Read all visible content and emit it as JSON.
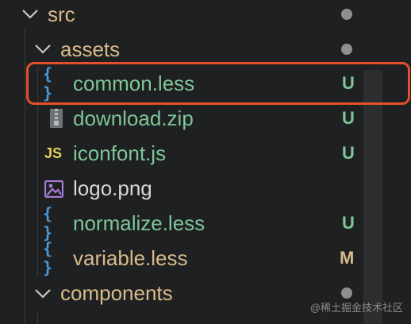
{
  "explorer": {
    "items": [
      {
        "label": "src",
        "type": "folder",
        "level": 0,
        "status": "",
        "dot": true
      },
      {
        "label": "assets",
        "type": "folder",
        "level": 1,
        "status": "",
        "dot": true
      },
      {
        "label": "common.less",
        "type": "less",
        "level": 2,
        "status": "U",
        "icon": "braces-icon"
      },
      {
        "label": "download.zip",
        "type": "zip",
        "level": 2,
        "status": "U",
        "icon": "zip-icon"
      },
      {
        "label": "iconfont.js",
        "type": "js",
        "level": 2,
        "status": "U",
        "icon": "js-icon"
      },
      {
        "label": "logo.png",
        "type": "image",
        "level": 2,
        "status": "",
        "icon": "image-icon"
      },
      {
        "label": "normalize.less",
        "type": "less",
        "level": 2,
        "status": "U",
        "icon": "braces-icon"
      },
      {
        "label": "variable.less",
        "type": "less",
        "level": 2,
        "status": "M",
        "icon": "braces-icon"
      },
      {
        "label": "components",
        "type": "folder",
        "level": 1,
        "status": "",
        "dot": true
      }
    ],
    "js_icon_text": "JS",
    "braces_text": "{ }"
  },
  "colors": {
    "untracked": "#7ec699",
    "modified": "#d9bb8a",
    "folder": "#d9bb8a",
    "highlight": "#e2502b",
    "background": "#1f2021"
  },
  "watermark": "@稀土掘金技术社区"
}
